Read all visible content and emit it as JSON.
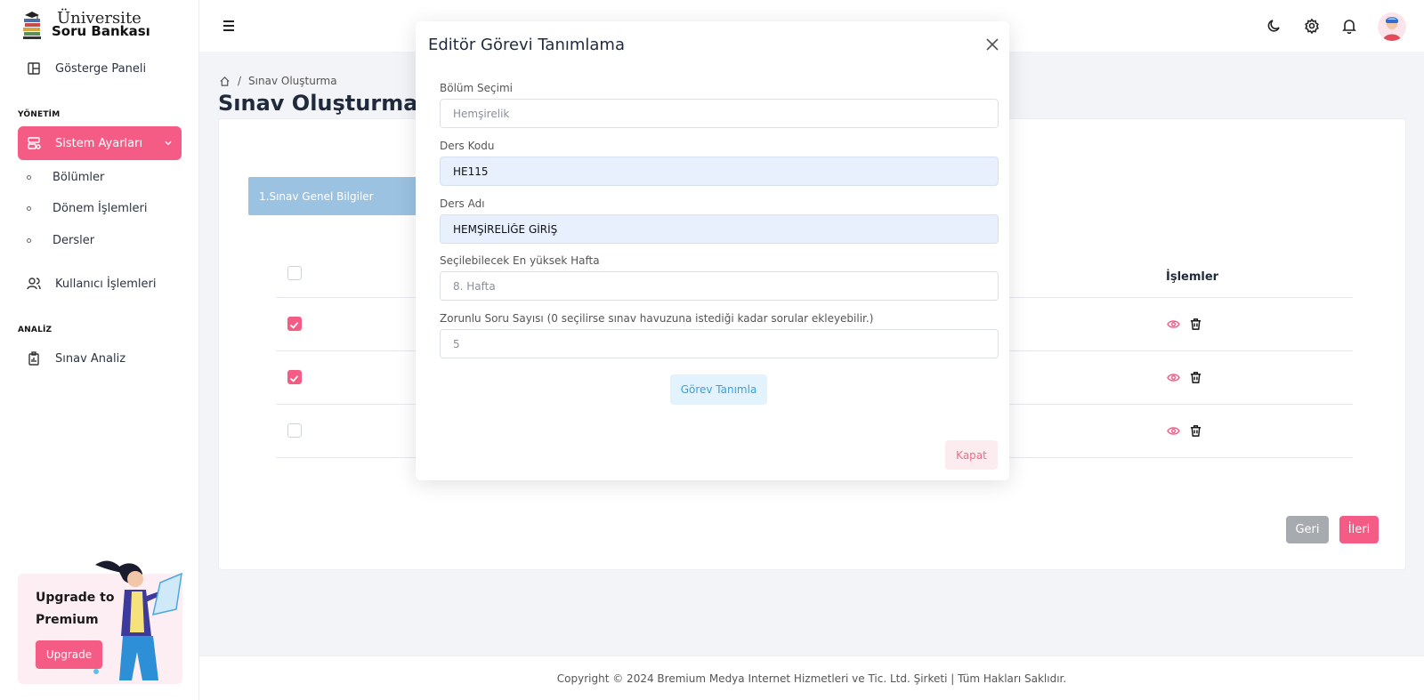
{
  "colors": {
    "accent": "#f45c86",
    "step": "#9cc2e1",
    "info": "#3aa0dc"
  },
  "logo": {
    "line1": "Üniversite",
    "line2": "Soru Bankası"
  },
  "sidebar": {
    "dashboard": "Gösterge Paneli",
    "section_management": "YÖNETİM",
    "system_settings": "Sistem Ayarları",
    "sub_items": [
      "Bölümler",
      "Dönem İşlemleri",
      "Dersler"
    ],
    "users": "Kullanıcı İşlemleri",
    "section_analysis": "ANALİZ",
    "exam_analysis": "Sınav Analiz"
  },
  "promo": {
    "text": "Upgrade to Premium",
    "button": "Upgrade"
  },
  "header": {
    "icons": [
      "menu-icon",
      "moon-icon",
      "gear-icon",
      "bell-icon",
      "avatar"
    ]
  },
  "breadcrumb": {
    "current": "Sınav Oluşturma"
  },
  "page": {
    "title": "Sınav Oluşturma",
    "step_label": "1.Sınav Genel Bilgiler",
    "table_header_actions": "İşlemler",
    "rows_checked": [
      true,
      true,
      false
    ],
    "back": "Geri",
    "next": "İleri"
  },
  "modal": {
    "title": "Editör Görevi Tanımlama",
    "fields": [
      {
        "label": "Bölüm Seçimi",
        "placeholder": "Hemşirelik",
        "value": ""
      },
      {
        "label": "Ders Kodu",
        "placeholder": "",
        "value": "HE115"
      },
      {
        "label": "Ders Adı",
        "placeholder": "",
        "value": "HEMŞİRELİĞE GİRİŞ"
      },
      {
        "label": "Seçilebilecek En yüksek Hafta",
        "placeholder": "8. Hafta",
        "value": ""
      },
      {
        "label": "Zorunlu Soru Sayısı (0 seçilirse sınav havuzuna istediği kadar sorular ekleyebilir.)",
        "placeholder": "5",
        "value": ""
      }
    ],
    "define_button": "Görev Tanımla",
    "close_button": "Kapat"
  },
  "footer": {
    "text": "Copyright © 2024 Bremium Medya Internet Hizmetleri ve Tic. Ltd. Şirketi | Tüm Hakları Saklıdır."
  }
}
